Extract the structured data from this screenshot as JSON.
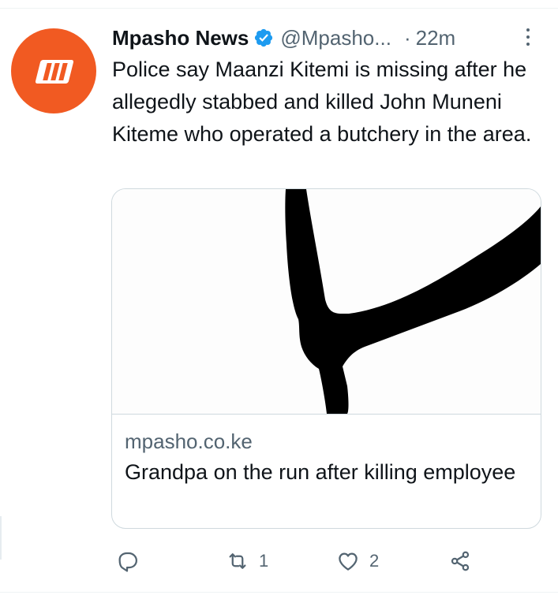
{
  "tweet": {
    "author_name": "Mpasho News",
    "handle": "@Mpasho...",
    "separator": "·",
    "time": "22m",
    "text": "Police say Maanzi Kitemi is missing after he allegedly stabbed and killed John Muneni Kiteme who operated a butchery in the area.",
    "avatar_color": "#f15a22"
  },
  "card": {
    "domain": "mpasho.co.ke",
    "title": "Grandpa on the run after killing employee"
  },
  "actions": {
    "reply_icon": "reply-icon",
    "retweet_icon": "retweet-icon",
    "retweet_count": "1",
    "like_icon": "heart-icon",
    "like_count": "2",
    "share_icon": "share-icon"
  },
  "colors": {
    "text": "#0f1419",
    "secondary": "#536471",
    "verified": "#1d9bf0",
    "border": "#cfd9de"
  }
}
